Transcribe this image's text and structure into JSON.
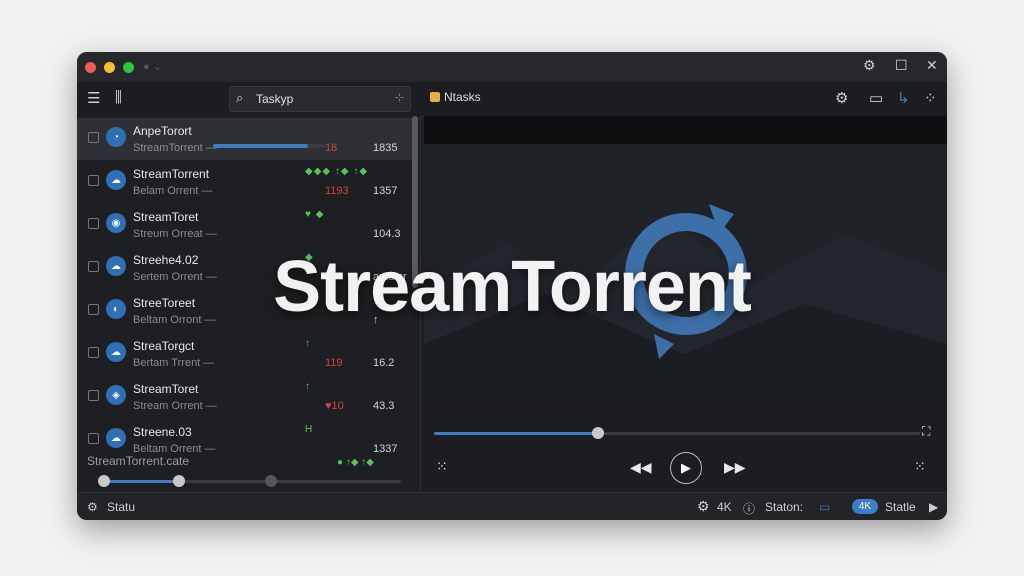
{
  "window": {
    "controls": {
      "settings": "⚙",
      "maximize": "☐",
      "close": "✕"
    }
  },
  "toolbar": {
    "search_value": "Taskyp",
    "panel_title": "Ntasks",
    "icons": [
      "list-icon",
      "columns-icon",
      "search-icon",
      "settings-icon",
      "subtitle-icon",
      "cast-icon",
      "grid-icon"
    ]
  },
  "torrents": [
    {
      "name": "AnpeTorort",
      "sub": "StreamTorrent —",
      "right": "18",
      "value": "1835",
      "progress": 0.85,
      "selected": true
    },
    {
      "name": "StreamTorrent",
      "sub": "Belam Orrent —",
      "badges": "◆◆◆ ↑◆ ↑◆",
      "right": "1193",
      "value": "1357"
    },
    {
      "name": "StreamToret",
      "sub": "Streum Orreat —",
      "badges": "♥ ◆",
      "right": "",
      "value": "104.3"
    },
    {
      "name": "Streehe4.02",
      "sub": "Sertem Orrent —",
      "badges": "◆",
      "right": "",
      "value": "amd\nsr"
    },
    {
      "name": "StreeToreet",
      "sub": "Beltam Orront —",
      "badges": "↑",
      "right": "",
      "value": "↑"
    },
    {
      "name": "StreaTorgct",
      "sub": "Bertam Trrent —",
      "badges": "↑",
      "right": "119",
      "value": "16.2"
    },
    {
      "name": "StreamToret",
      "sub": "Stream Orrent —",
      "badges": "↑",
      "right": "♥10",
      "value": "43.3"
    },
    {
      "name": "Streene.03",
      "sub": "Beltam Orrent —",
      "badges": "H",
      "right": "",
      "value": "1337"
    }
  ],
  "left_footer": "StreamTorrent.cate",
  "player": {
    "overlay_title": "StreamTorrent",
    "seek_progress": 0.33
  },
  "status_bar": {
    "left": "Statu",
    "quality": "4K",
    "station": "Staton:",
    "badge": "4K",
    "right": "Statle"
  },
  "colors": {
    "accent": "#3d7cc9",
    "bg": "#1e1f22"
  }
}
